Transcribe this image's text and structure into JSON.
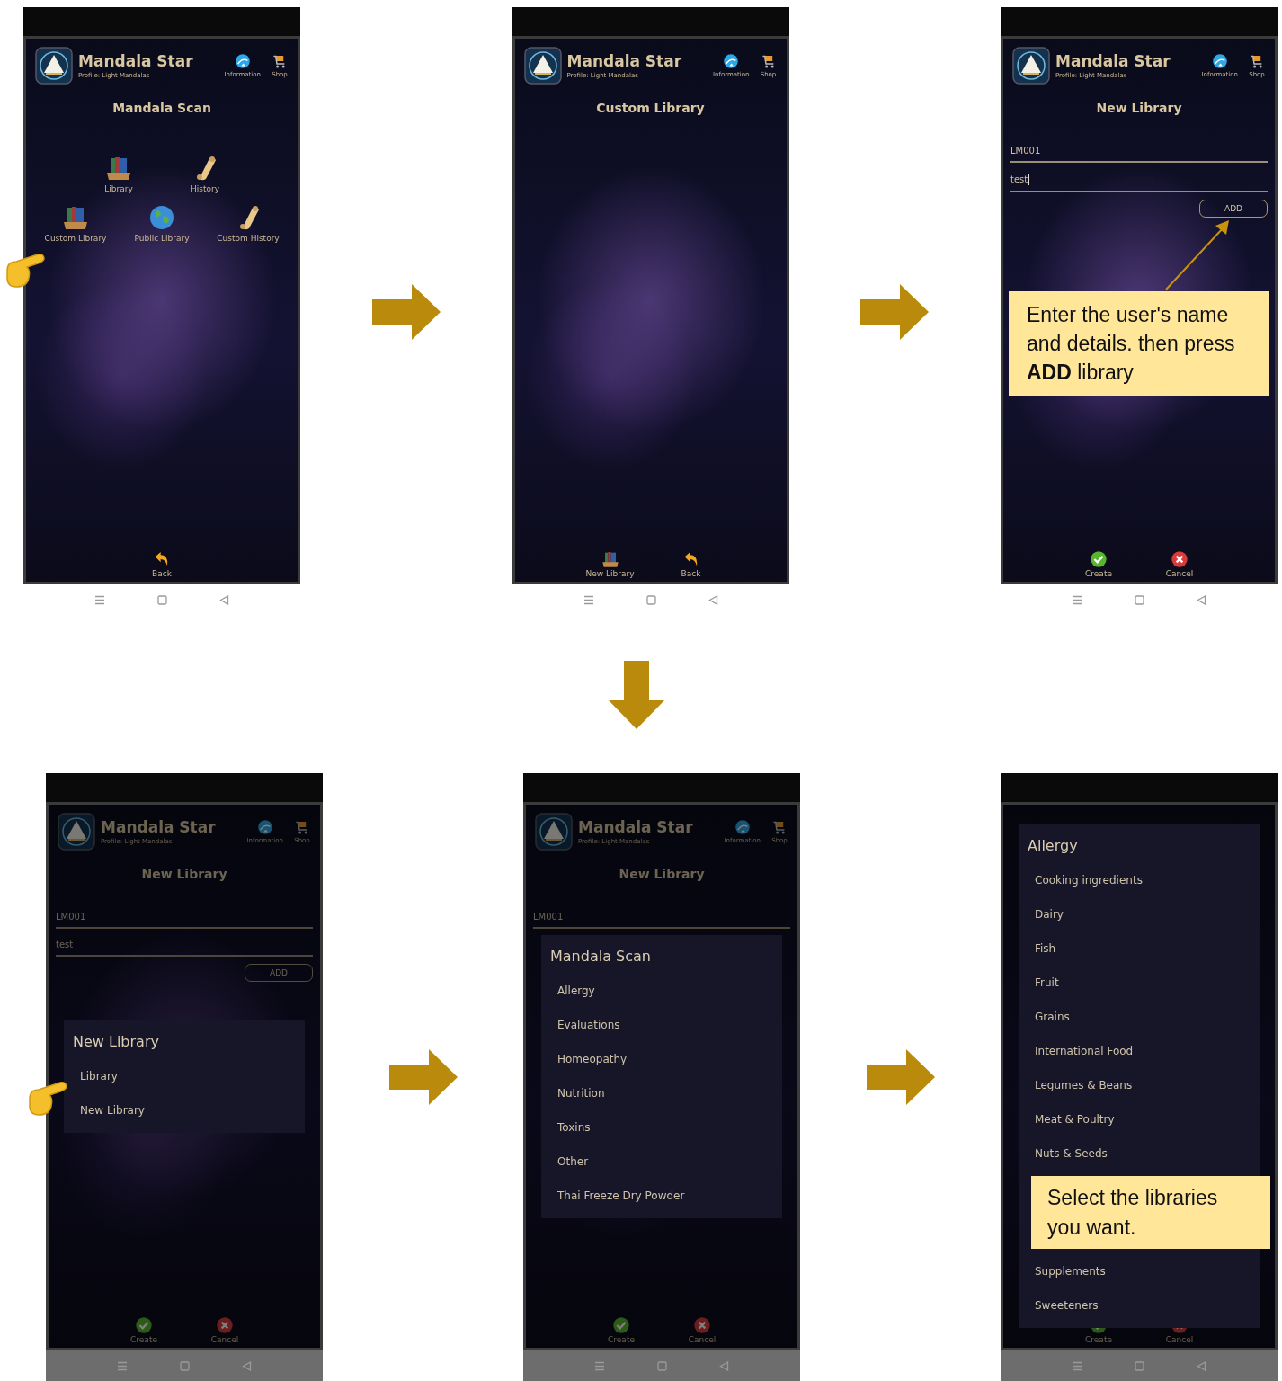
{
  "rows": [
    {
      "items": [
        {
          "kind": "screen",
          "dimmed": false,
          "header": {
            "app_name": "Mandala Star",
            "profile": "Profile: Light Mandalas",
            "links": [
              {
                "label": "Information",
                "kind": "info"
              },
              {
                "label": "Shop",
                "kind": "cart"
              }
            ]
          },
          "title": "Mandala Scan",
          "menu_rows": [
            [
              {
                "label": "Library",
                "kind": "books",
                "pointer": false
              },
              {
                "label": "History",
                "kind": "scroll",
                "pointer": false
              }
            ],
            [
              {
                "label": "Custom Library",
                "kind": "books",
                "pointer": true
              },
              {
                "label": "Public Library",
                "kind": "globe",
                "pointer": false
              },
              {
                "label": "Custom History",
                "kind": "scroll",
                "pointer": false
              }
            ]
          ],
          "actions": [
            {
              "label": "Back",
              "kind": "back"
            }
          ]
        },
        {
          "kind": "arrow_right"
        },
        {
          "kind": "screen",
          "dimmed": false,
          "header": {
            "app_name": "Mandala Star",
            "profile": "Profile: Light Mandalas",
            "links": [
              {
                "label": "Information",
                "kind": "info"
              },
              {
                "label": "Shop",
                "kind": "cart"
              }
            ]
          },
          "title": "Custom Library",
          "actions": [
            {
              "label": "New Library",
              "kind": "books"
            },
            {
              "label": "Back",
              "kind": "back"
            }
          ]
        },
        {
          "kind": "arrow_right"
        },
        {
          "kind": "screen",
          "dimmed": false,
          "header": {
            "app_name": "Mandala Star",
            "profile": "Profile: Light Mandalas",
            "links": [
              {
                "label": "Information",
                "kind": "info"
              },
              {
                "label": "Shop",
                "kind": "cart"
              }
            ]
          },
          "title": "New Library",
          "fields": [
            {
              "value": "LM001",
              "focused": false
            },
            {
              "value": "test",
              "focused": true
            }
          ],
          "add_button": "ADD",
          "callout": {
            "text": "Enter the user's name and details. then press **ADD** library"
          },
          "actions": [
            {
              "label": "Create",
              "kind": "check"
            },
            {
              "label": "Cancel",
              "kind": "cancel"
            }
          ]
        }
      ]
    },
    {
      "items": [
        {
          "kind": "arrow_down"
        }
      ]
    },
    {
      "items": [
        {
          "kind": "screen",
          "dimmed": true,
          "header": {
            "app_name": "Mandala Star",
            "profile": "Profile: Light Mandalas",
            "links": [
              {
                "label": "Information",
                "kind": "info"
              },
              {
                "label": "Shop",
                "kind": "cart"
              }
            ]
          },
          "title": "New Library",
          "fields": [
            {
              "value": "LM001",
              "focused": false
            },
            {
              "value": "test",
              "focused": false
            }
          ],
          "add_button": "ADD",
          "actions": [
            {
              "label": "Create",
              "kind": "check"
            },
            {
              "label": "Cancel",
              "kind": "cancel"
            }
          ],
          "dialog": {
            "title": "New Library",
            "items": [
              {
                "kind": "item",
                "label": "Library",
                "pointer": true
              },
              {
                "kind": "item",
                "label": "New Library",
                "pointer": false
              }
            ]
          }
        },
        {
          "kind": "arrow_right"
        },
        {
          "kind": "screen",
          "dimmed": true,
          "header": {
            "app_name": "Mandala Star",
            "profile": "Profile: Light Mandalas",
            "links": [
              {
                "label": "Information",
                "kind": "info"
              },
              {
                "label": "Shop",
                "kind": "cart"
              }
            ]
          },
          "title": "New Library",
          "fields": [
            {
              "value": "LM001",
              "focused": false
            }
          ],
          "actions": [
            {
              "label": "Create",
              "kind": "check"
            },
            {
              "label": "Cancel",
              "kind": "cancel"
            }
          ],
          "dialog": {
            "title": "Mandala Scan",
            "items": [
              {
                "kind": "item",
                "label": "Allergy",
                "pointer": false
              },
              {
                "kind": "item",
                "label": "Evaluations",
                "pointer": false
              },
              {
                "kind": "item",
                "label": "Homeopathy",
                "pointer": false
              },
              {
                "kind": "item",
                "label": "Nutrition",
                "pointer": false
              },
              {
                "kind": "item",
                "label": "Toxins",
                "pointer": false
              },
              {
                "kind": "item",
                "label": "Other",
                "pointer": false
              },
              {
                "kind": "item",
                "label": "Thai Freeze Dry Powder",
                "pointer": false
              }
            ]
          }
        },
        {
          "kind": "arrow_right"
        },
        {
          "kind": "screen",
          "dimmed": true,
          "actions": [
            {
              "label": "Create",
              "kind": "check"
            },
            {
              "label": "Cancel",
              "kind": "cancel"
            }
          ],
          "dialog": {
            "title": "Allergy",
            "items": [
              {
                "kind": "item",
                "label": "Cooking ingredients",
                "pointer": false
              },
              {
                "kind": "item",
                "label": "Dairy",
                "pointer": false
              },
              {
                "kind": "item",
                "label": "Fish",
                "pointer": false
              },
              {
                "kind": "item",
                "label": "Fruit",
                "pointer": false
              },
              {
                "kind": "item",
                "label": "Grains",
                "pointer": false
              },
              {
                "kind": "item",
                "label": "International Food",
                "pointer": false
              },
              {
                "kind": "item",
                "label": "Legumes & Beans",
                "pointer": false
              },
              {
                "kind": "item",
                "label": "Meat & Poultry",
                "pointer": false
              },
              {
                "kind": "item",
                "label": "Nuts & Seeds",
                "pointer": false
              },
              {
                "kind": "callout",
                "text": "Select the libraries you want."
              },
              {
                "kind": "item",
                "label": "Supplements",
                "pointer": false
              },
              {
                "kind": "item",
                "label": "Sweeteners",
                "pointer": false
              }
            ]
          }
        }
      ]
    }
  ]
}
